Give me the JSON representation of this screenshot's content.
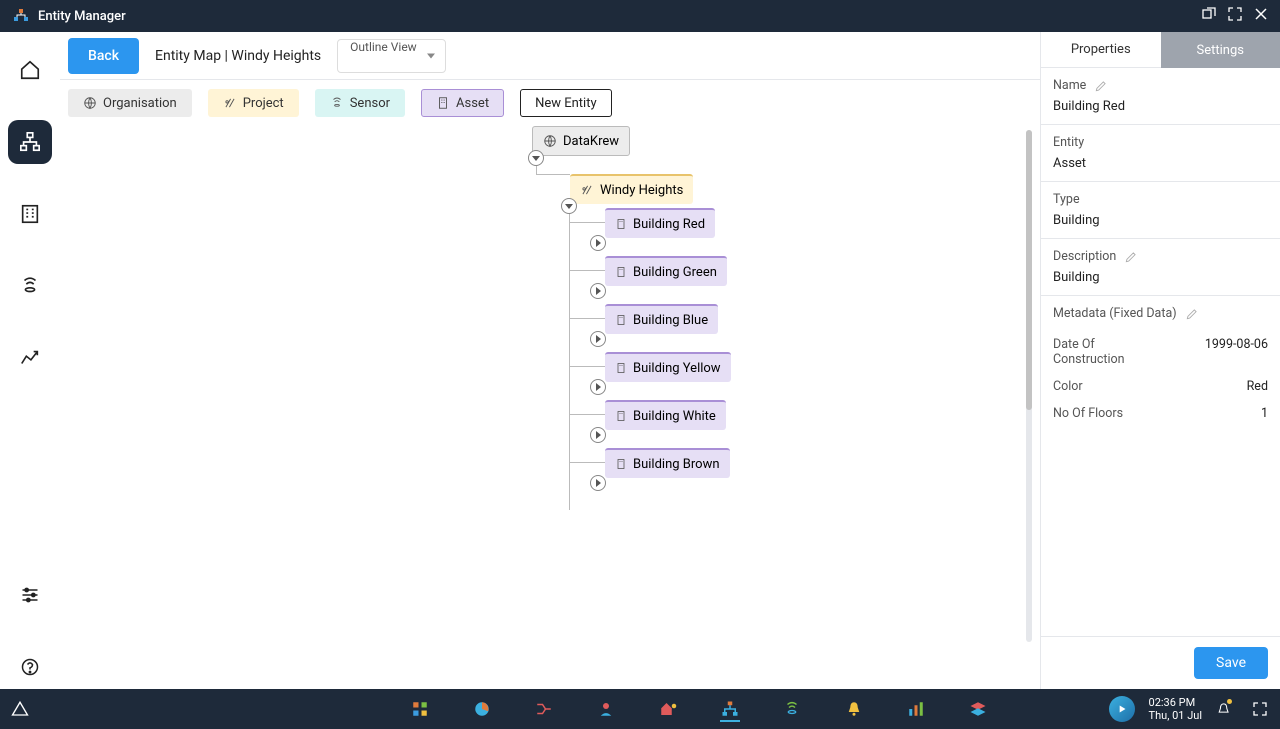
{
  "app_title": "Entity Manager",
  "topbar": {
    "back_label": "Back",
    "breadcrumb": "Entity Map | Windy Heights",
    "view_mode": "Outline View"
  },
  "legend": {
    "organisation": "Organisation",
    "project": "Project",
    "sensor": "Sensor",
    "asset": "Asset",
    "new_entity": "New Entity"
  },
  "tree": {
    "root": "DataKrew",
    "project": "Windy Heights",
    "assets": [
      "Building Red",
      "Building Green",
      "Building Blue",
      "Building Yellow",
      "Building White",
      "Building Brown"
    ]
  },
  "props": {
    "tab_properties": "Properties",
    "tab_settings": "Settings",
    "name_label": "Name",
    "name_value": "Building Red",
    "entity_label": "Entity",
    "entity_value": "Asset",
    "type_label": "Type",
    "type_value": "Building",
    "description_label": "Description",
    "description_value": "Building",
    "metadata_label": "Metadata (Fixed Data)",
    "metadata": [
      {
        "k": "Date Of Construction",
        "v": "1999-08-06"
      },
      {
        "k": "Color",
        "v": "Red"
      },
      {
        "k": "No Of Floors",
        "v": "1"
      }
    ],
    "save_label": "Save"
  },
  "taskbar": {
    "time": "02:36 PM",
    "date": "Thu, 01 Jul"
  }
}
